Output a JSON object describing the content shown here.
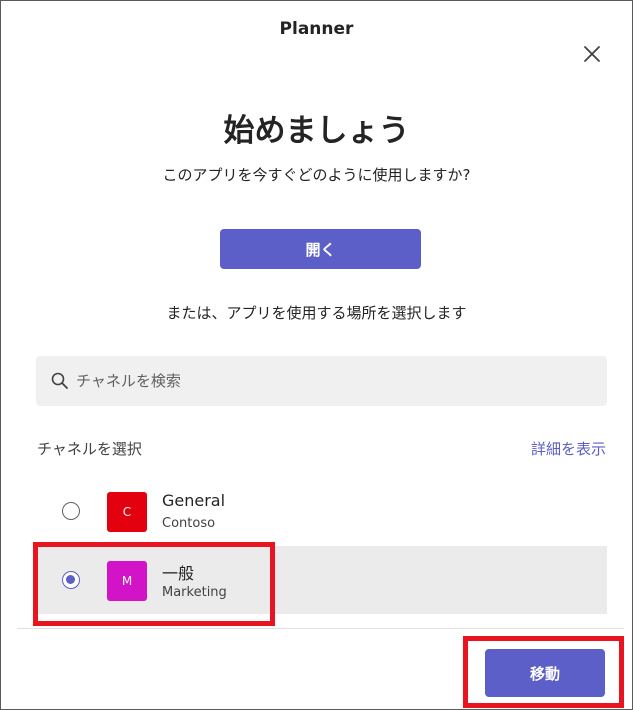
{
  "dialog": {
    "app_title": "Planner",
    "heading": "始めましょう",
    "question": "このアプリを今すぐどのように使用しますか?",
    "open_button": "開く",
    "or_text": "または、アプリを使用する場所を選択します"
  },
  "search": {
    "placeholder": "チャネルを検索",
    "value": ""
  },
  "channels": {
    "section_label": "チャネルを選択",
    "details_link": "詳細を表示",
    "items": [
      {
        "initial": "C",
        "name": "General",
        "team": "Contoso",
        "color": "#e3000f",
        "selected": false
      },
      {
        "initial": "M",
        "name": "一般",
        "team": "Marketing",
        "color": "#d313c8",
        "selected": true
      }
    ]
  },
  "footer": {
    "go_button": "移動"
  },
  "colors": {
    "accent": "#5b5fc7",
    "highlight": "#e8141f"
  },
  "icons": [
    "close-icon",
    "search-icon"
  ]
}
